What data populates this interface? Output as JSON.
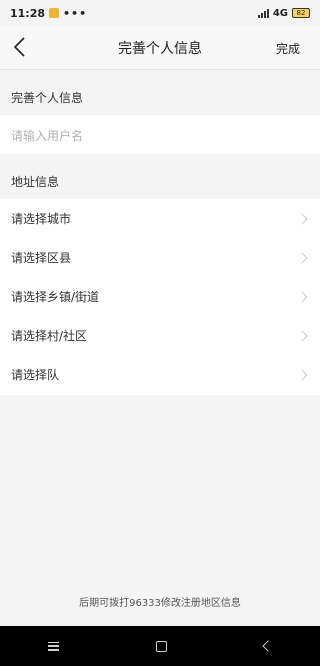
{
  "status_bar": {
    "time": "11:28",
    "dots": "•••",
    "network": "4G",
    "battery": "82"
  },
  "header": {
    "title": "完善个人信息",
    "done_label": "完成"
  },
  "personal_section": {
    "title": "完善个人信息",
    "username_placeholder": "请输入用户名"
  },
  "address_section": {
    "title": "地址信息",
    "items": [
      {
        "label": "请选择城市"
      },
      {
        "label": "请选择区县"
      },
      {
        "label": "请选择乡镇/街道"
      },
      {
        "label": "请选择村/社区"
      },
      {
        "label": "请选择队"
      }
    ]
  },
  "footer": {
    "note": "后期可拨打96333修改注册地区信息"
  },
  "colors": {
    "background": "#f4f4f4",
    "card": "#ffffff",
    "placeholder": "#b3b3b3"
  }
}
